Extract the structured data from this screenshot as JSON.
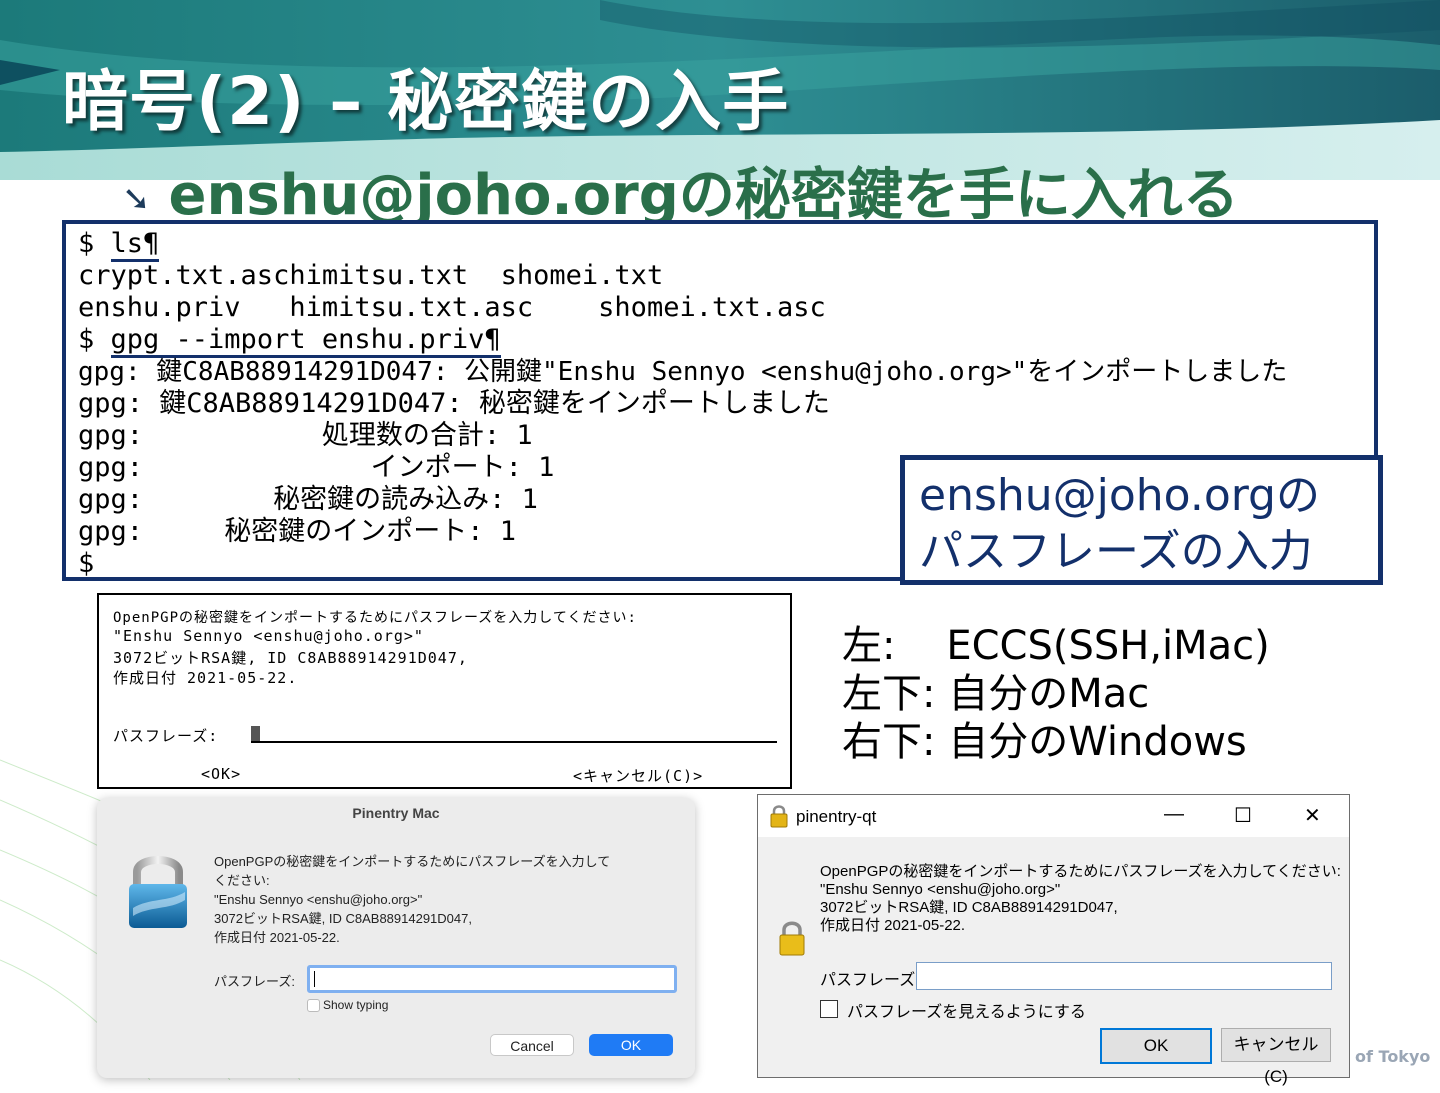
{
  "slide": {
    "title": "暗号(2) – 秘密鍵の入手",
    "bullet": "enshu@joho.orgの秘密鍵を手に入れる",
    "footer": "of Tokyo"
  },
  "terminal": {
    "lines": [
      "$ ls¶",
      "crypt.txt.aschimitsu.txt  shomei.txt",
      "enshu.priv   himitsu.txt.asc    shomei.txt.asc",
      "$ gpg --import enshu.priv¶",
      "gpg: 鍵C8AB88914291D047: 公開鍵\"Enshu Sennyo <enshu@joho.org>\"をインポートしました",
      "gpg: 鍵C8AB88914291D047: 秘密鍵をインポートしました",
      "gpg:           処理数の合計: 1",
      "gpg:              インポート: 1",
      "gpg:        秘密鍵の読み込み: 1",
      "gpg:     秘密鍵のインポート: 1",
      "$"
    ]
  },
  "callout": {
    "line1": "enshu@joho.orgの",
    "line2": "パスフレーズの入力"
  },
  "curses_dialog": {
    "line1": "OpenPGPの秘密鍵をインポートするためにパスフレーズを入力してください:",
    "line2": "\"Enshu Sennyo <enshu@joho.org>\"",
    "line3": "3072ビットRSA鍵, ID C8AB88914291D047,",
    "line4": "作成日付 2021-05-22.",
    "passphrase_label": "パスフレーズ:",
    "ok_label": "<OK>",
    "cancel_label": "<キャンセル(C)>"
  },
  "notes": {
    "line1": "左:    ECCS(SSH,iMac)",
    "line2": "左下: 自分のMac",
    "line3": "右下: 自分のWindows"
  },
  "mac_dialog": {
    "title": "Pinentry Mac",
    "message": "OpenPGPの秘密鍵をインポートするためにパスフレーズを入力して\nください:\n\"Enshu Sennyo <enshu@joho.org>\"\n3072ビットRSA鍵, ID C8AB88914291D047,\n作成日付 2021-05-22.",
    "passphrase_label": "パスフレーズ:",
    "passphrase_value": "",
    "show_typing_label": "Show typing",
    "cancel_label": "Cancel",
    "ok_label": "OK",
    "icon": "lock-icon",
    "accent": "#1f7bf5"
  },
  "win_dialog": {
    "title": "pinentry-qt",
    "message": "OpenPGPの秘密鍵をインポートするためにパスフレーズを入力してください:\n\"Enshu Sennyo <enshu@joho.org>\"\n3072ビットRSA鍵, ID C8AB88914291D047,\n作成日付 2021-05-22.",
    "passphrase_label": "パスフレーズ:",
    "passphrase_value": "",
    "show_label": "パスフレーズを見えるようにする",
    "ok_label": "OK",
    "cancel_label": "キャンセル(C)",
    "minimize": "—",
    "maximize": "☐",
    "close": "✕",
    "icon": "lock-icon"
  }
}
